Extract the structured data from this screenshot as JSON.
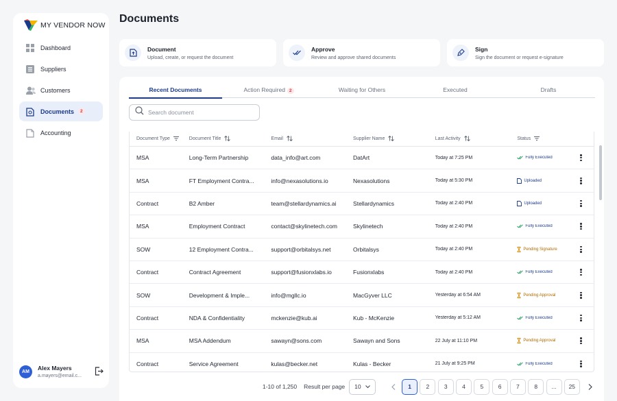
{
  "brand": {
    "logo_text": "MY VENDOR NOW"
  },
  "sidebar": {
    "items": [
      {
        "label": "Dashboard",
        "icon": "grid-icon"
      },
      {
        "label": "Suppliers",
        "icon": "list-icon"
      },
      {
        "label": "Customers",
        "icon": "users-icon"
      },
      {
        "label": "Documents",
        "icon": "document-icon",
        "badge": "2",
        "active": true
      },
      {
        "label": "Accounting",
        "icon": "file-icon"
      }
    ]
  },
  "user": {
    "initials": "AM",
    "name": "Alex Mayers",
    "email": "a.mayers@email.c..."
  },
  "page": {
    "title": "Documents"
  },
  "cards": [
    {
      "title": "Document",
      "desc": "Upload, create, or request the document",
      "icon": "upload-document-icon"
    },
    {
      "title": "Approve",
      "desc": "Review and approve shared documents",
      "icon": "double-check-icon"
    },
    {
      "title": "Sign",
      "desc": "Sign the document or request e-signature",
      "icon": "pen-sign-icon"
    }
  ],
  "tabs": [
    {
      "label": "Recent Documents",
      "active": true
    },
    {
      "label": "Action Required",
      "badge": "2"
    },
    {
      "label": "Waiting for Others"
    },
    {
      "label": "Executed"
    },
    {
      "label": "Drafts"
    }
  ],
  "search": {
    "placeholder": "Search document"
  },
  "table": {
    "headers": [
      "Document Type",
      "Document Title",
      "Email",
      "Supplier Name",
      "Last Activity",
      "Status"
    ],
    "rows": [
      {
        "type": "MSA",
        "title": "Long-Term Partnership",
        "email": "data_info@art.com",
        "supplier": "DatArt",
        "activity": "Today at 7:25 PM",
        "status": "Fully Executed",
        "kind": "exec"
      },
      {
        "type": "MSA",
        "title": "FT Employment Contra...",
        "email": "info@nexasolutions.io",
        "supplier": "Nexasolutions",
        "activity": "Today at 5:30 PM",
        "status": "Uploaded",
        "kind": "upl"
      },
      {
        "type": "Contract",
        "title": "B2 Amber",
        "email": "team@stellardynamics.ai",
        "supplier": "Stellardynamics",
        "activity": "Today at 2:40 PM",
        "status": "Uploaded",
        "kind": "upl"
      },
      {
        "type": "MSA",
        "title": "Employment Contract",
        "email": "contact@skylinetech.com",
        "supplier": "Skylinetech",
        "activity": "Today at 2:40 PM",
        "status": "Fully Executed",
        "kind": "exec"
      },
      {
        "type": "SOW",
        "title": "12 Employment Contra...",
        "email": "support@orbitalsys.net",
        "supplier": "Orbitalsys",
        "activity": "Today at 2:40 PM",
        "status": "Pending Signature",
        "kind": "pend"
      },
      {
        "type": "Contract",
        "title": "Contract Agreement",
        "email": "support@fusionxlabs.io",
        "supplier": "Fusionxlabs",
        "activity": "Today at 2:40 PM",
        "status": "Fully Executed",
        "kind": "exec"
      },
      {
        "type": "SOW",
        "title": "Development & Imple...",
        "email": "info@mgllc.io",
        "supplier": "MacGyver LLC",
        "activity": "Yesterday at 6:54 AM",
        "status": "Pending Approval",
        "kind": "pend"
      },
      {
        "type": "Contract",
        "title": "NDA & Confidentiality",
        "email": "mckenzie@kub.ai",
        "supplier": "Kub - McKenzie",
        "activity": "Yesterday at 5:12 AM",
        "status": "Fully Executed",
        "kind": "exec"
      },
      {
        "type": "MSA",
        "title": "MSA Addendum",
        "email": "sawayn@sons.com",
        "supplier": "Sawayn and Sons",
        "activity": "22 July at 11:10 PM",
        "status": "Pending Approval",
        "kind": "pend"
      },
      {
        "type": "Contract",
        "title": "Service Agreement",
        "email": "kulas@becker.net",
        "supplier": "Kulas - Becker",
        "activity": "21 July at 9:25 PM",
        "status": "Fully Executed",
        "kind": "exec"
      }
    ]
  },
  "pagination": {
    "summary": "1-10 of 1,250",
    "per_page_label": "Result per page",
    "per_page": "10",
    "pages": [
      "1",
      "2",
      "3",
      "4",
      "5",
      "6",
      "7",
      "8",
      "...",
      "25"
    ],
    "current": "1"
  },
  "colors": {
    "accent": "#1b3a8a",
    "primary": "#2f5fd6",
    "executed": "#2e9e6a",
    "pending": "#e08a00",
    "badge": "#d9363e"
  }
}
